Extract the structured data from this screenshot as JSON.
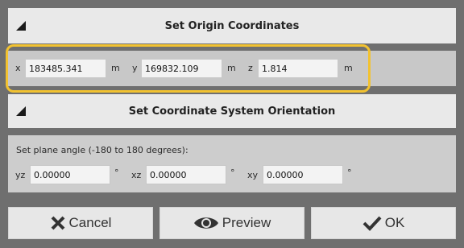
{
  "origin": {
    "title": "Set Origin Coordinates",
    "x_label": "x",
    "x_value": "183485.341",
    "x_unit": "m",
    "y_label": "y",
    "y_value": "169832.109",
    "y_unit": "m",
    "z_label": "z",
    "z_value": "1.814",
    "z_unit": "m"
  },
  "orientation": {
    "title": "Set Coordinate System Orientation",
    "plane_angle_label": "Set plane angle (-180 to 180 degrees):",
    "yz_label": "yz",
    "yz_value": "0.00000",
    "yz_unit": "°",
    "xz_label": "xz",
    "xz_value": "0.00000",
    "xz_unit": "°",
    "xy_label": "xy",
    "xy_value": "0.00000",
    "xy_unit": "°"
  },
  "buttons": {
    "cancel_label": "Cancel",
    "preview_label": "Preview",
    "ok_label": "OK"
  },
  "colors": {
    "highlight": "#f2c230",
    "background": "#6f6f6f",
    "header": "#e9e9e9"
  }
}
